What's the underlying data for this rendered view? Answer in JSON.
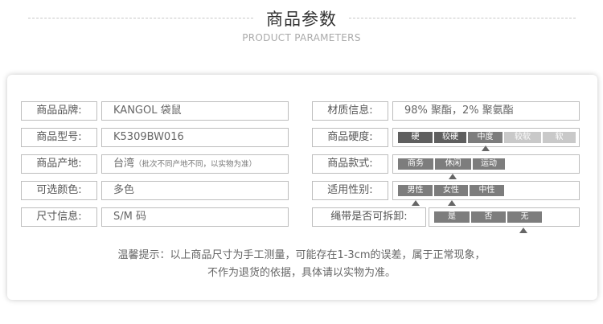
{
  "header": {
    "title": "商品参数",
    "subtitle": "PRODUCT PARAMETERS"
  },
  "left_rows": [
    {
      "label": "商品品牌:",
      "value": "KANGOL 袋鼠"
    },
    {
      "label": "商品型号:",
      "value": "K5309BW016"
    },
    {
      "label": "商品产地:",
      "value": "台湾",
      "value_note": "（批次不同产地不同，以实物为准）"
    },
    {
      "label": "可选颜色:",
      "value": "多色"
    },
    {
      "label": "尺寸信息:",
      "value": "S/M 码"
    }
  ],
  "right_rows": {
    "material": {
      "label": "材质信息:",
      "value": "98% 聚酯，2% 聚氨酯"
    },
    "hardness": {
      "label": "商品硬度:",
      "options": [
        "硬",
        "较硬",
        "中度",
        "较软",
        "软"
      ],
      "selected": "中度"
    },
    "style": {
      "label": "商品款式:",
      "options": [
        "商务",
        "休闲",
        "运动"
      ],
      "selected": "休闲"
    },
    "gender": {
      "label": "适用性别:",
      "options": [
        "男性",
        "女性",
        "中性"
      ],
      "selected": [
        "男性",
        "女性"
      ]
    },
    "strap": {
      "label": "绳带是否可拆卸:",
      "options": [
        "是",
        "否",
        "无"
      ],
      "selected": "无"
    }
  },
  "note": {
    "line1": "温馨提示：以上商品尺寸为手工测量，可能存在1-3cm的误差，属于正常现象，",
    "line2": "不作为退货的依据，具体请以实物为准。"
  },
  "colors": {
    "segment_dark": "#7d7d7d",
    "segment_light": "#c9c9c9",
    "border": "#bdbdbd"
  }
}
